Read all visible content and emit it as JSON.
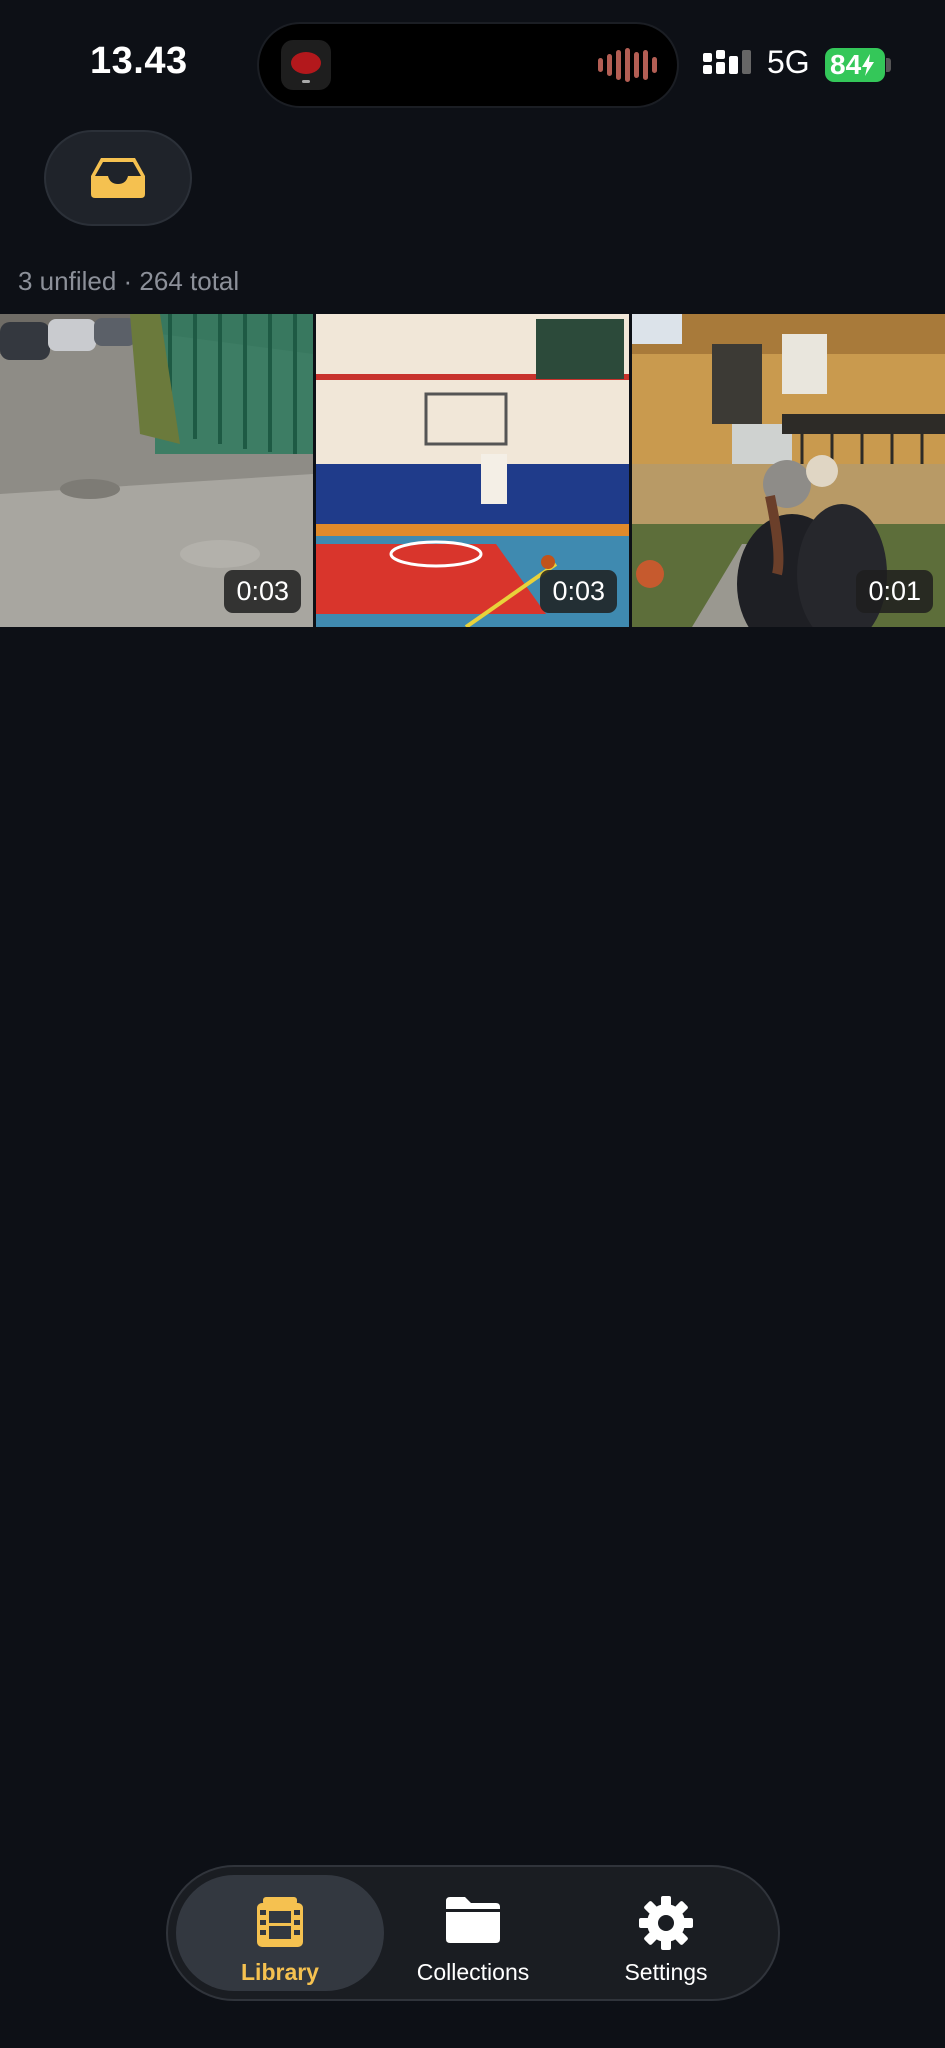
{
  "status_bar": {
    "time": "13.43",
    "network": "5G",
    "battery": "84"
  },
  "header": {
    "inbox_icon": "inbox-tray-icon"
  },
  "library": {
    "summary": "3 unfiled · 264 total",
    "videos": [
      {
        "scene": "parking-lot-road",
        "duration": "0:03"
      },
      {
        "scene": "basketball-gym",
        "duration": "0:03"
      },
      {
        "scene": "courtyard-people",
        "duration": "0:01"
      }
    ]
  },
  "tabs": [
    {
      "label": "Library",
      "icon": "film-icon",
      "active": true
    },
    {
      "label": "Collections",
      "icon": "folder-icon",
      "active": false
    },
    {
      "label": "Settings",
      "icon": "gear-icon",
      "active": false
    }
  ],
  "colors": {
    "accent": "#f5c150",
    "background": "#0d1016",
    "battery": "#34c759"
  }
}
